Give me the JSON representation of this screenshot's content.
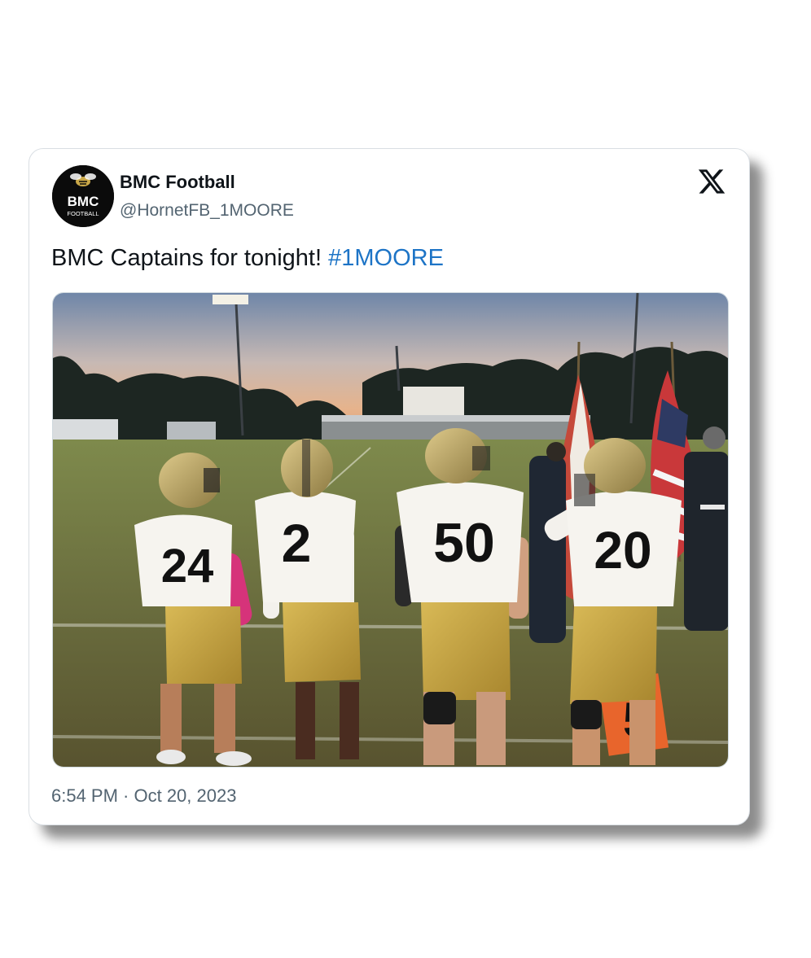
{
  "tweet": {
    "author_name": "BMC Football",
    "handle": "@HornetFB_1MOORE",
    "avatar_text": "BMC",
    "avatar_subtext": "FOOTBALL",
    "text": "BMC Captains for tonight! ",
    "hashtag": "#1MOORE",
    "timestamp": "6:54 PM · Oct 20, 2023"
  },
  "photo": {
    "jersey_numbers": [
      "24",
      "2",
      "50",
      "20"
    ],
    "field_marker": "5"
  },
  "colors": {
    "hashtag_blue": "#1d74c6",
    "jersey_gold": "#c9a748",
    "text_dark": "#0f1419",
    "text_muted": "#536471"
  },
  "icons": {
    "platform_logo": "x-logo-icon"
  }
}
